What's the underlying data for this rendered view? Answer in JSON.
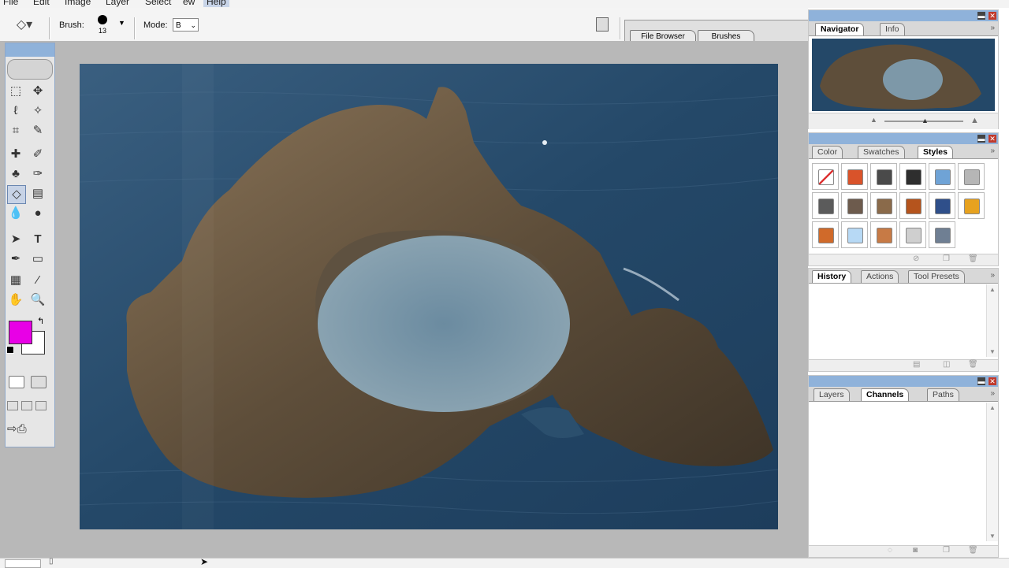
{
  "menu": [
    "File",
    "Edit",
    "Image",
    "Layer",
    "Select",
    "ew",
    "Help"
  ],
  "options_bar": {
    "brush_label": "Brush:",
    "brush_size": "13",
    "mode_label": "Mode:",
    "mode_value": "B",
    "well_tabs": [
      "File Browser",
      "Brushes"
    ]
  },
  "navigator_panel": {
    "tabs": [
      "Navigator",
      "Info"
    ],
    "active_tab": "Navigator"
  },
  "color_panel": {
    "tabs": [
      "Color",
      "Swatches",
      "Styles"
    ],
    "active_tab": "Styles",
    "styles": [
      {
        "name": "no-style",
        "color": "#ffffff"
      },
      {
        "name": "orange-glow-style",
        "color": "#d9532a"
      },
      {
        "name": "dark-gray-style",
        "color": "#4a4a4a"
      },
      {
        "name": "black-chrome-style",
        "color": "#2e2e2e"
      },
      {
        "name": "blue-glass-style",
        "color": "#6fa3d6"
      },
      {
        "name": "light-gray-style",
        "color": "#b6b6b6"
      },
      {
        "name": "dark-steel-style",
        "color": "#5b5b5b"
      },
      {
        "name": "brown-style",
        "color": "#6d5b4d"
      },
      {
        "name": "bronze-style",
        "color": "#8a6a4a"
      },
      {
        "name": "rust-style",
        "color": "#b5541d"
      },
      {
        "name": "blue-orange-pattern-style",
        "color": "#2f4f8a"
      },
      {
        "name": "yellow-orange-style",
        "color": "#e7a21f"
      },
      {
        "name": "orange-texture-style",
        "color": "#d06a2a"
      },
      {
        "name": "sky-blue-style",
        "color": "#b7d9f5"
      },
      {
        "name": "sunset-style",
        "color": "#c77a45"
      },
      {
        "name": "silver-frame-style",
        "color": "#cfcfcf"
      },
      {
        "name": "steel-blue-style",
        "color": "#6f7f93"
      }
    ]
  },
  "history_panel": {
    "tabs": [
      "History",
      "Actions",
      "Tool Presets"
    ],
    "active_tab": "History"
  },
  "layers_panel": {
    "tabs": [
      "Layers",
      "Channels",
      "Paths"
    ],
    "active_tab": "Channels"
  },
  "toolbox": {
    "foreground_color": "#e800e6",
    "background_color": "#ffffff"
  },
  "colors": {
    "panel_title": "#8fb2da",
    "workspace": "#b8b8b8"
  }
}
